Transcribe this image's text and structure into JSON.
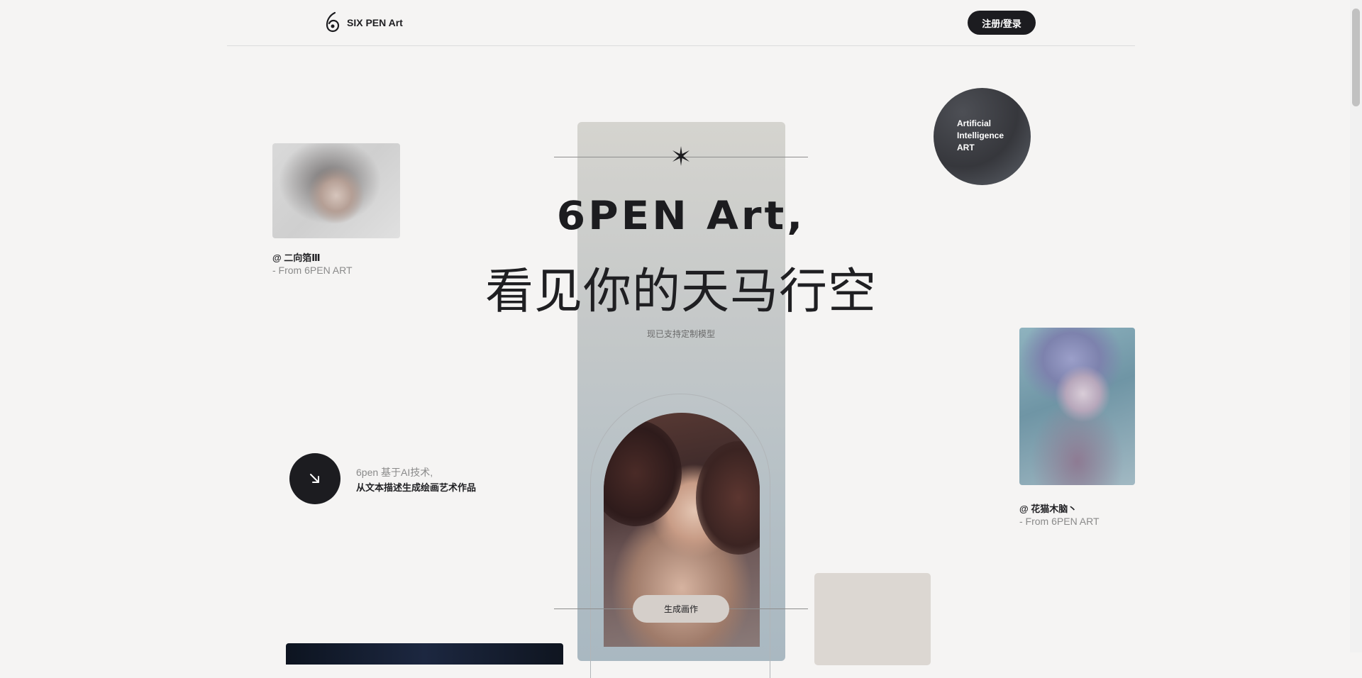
{
  "header": {
    "brand": "SIX PEN Art",
    "login_button": "注册/登录"
  },
  "hero": {
    "title": "6PEN Art,",
    "subtitle": "看见你的天马行空",
    "note": "现已支持定制模型",
    "generate_button": "生成画作"
  },
  "badge": {
    "lines": [
      "Artificial",
      "Intelligence",
      "ART"
    ]
  },
  "gallery": [
    {
      "author": "@ 二向箔Ⅲ",
      "source": "- From 6PEN ART"
    },
    {
      "author": "@ 花猫木脑丶",
      "source": "- From 6PEN ART"
    }
  ],
  "intro": {
    "line1": "6pen 基于AI技术,",
    "line2": "从文本描述生成绘画艺术作品"
  }
}
